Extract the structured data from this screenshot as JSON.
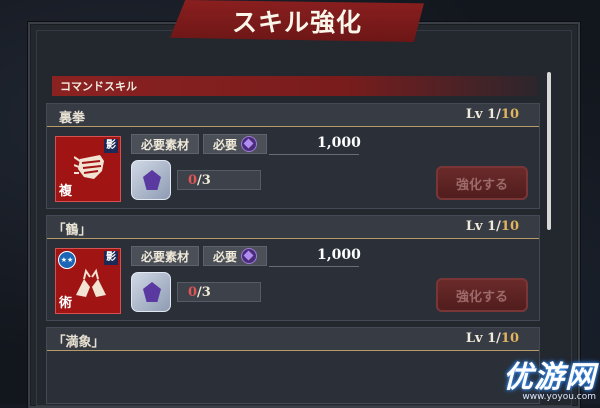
{
  "screen": {
    "title": "スキル強化"
  },
  "section": {
    "label": "コマンドスキル"
  },
  "skills": [
    {
      "name": "裏拳",
      "lv_label": "Lv",
      "lv_current": "1",
      "lv_max": "10",
      "kage": "影",
      "kind": "複",
      "req_material_label": "必要素材",
      "req_label": "必要",
      "req_value": "1,000",
      "count_have": "0",
      "count_need": "3",
      "button_label": "強化する"
    },
    {
      "name": "｢鶴｣",
      "lv_label": "Lv",
      "lv_current": "1",
      "lv_max": "10",
      "kage": "影",
      "kind": "術",
      "req_material_label": "必要素材",
      "req_label": "必要",
      "req_value": "1,000",
      "count_have": "0",
      "count_need": "3",
      "button_label": "強化する"
    },
    {
      "name": "｢満象｣",
      "lv_label": "Lv",
      "lv_current": "1",
      "lv_max": "10"
    }
  ],
  "watermark": {
    "main": "优游网",
    "sub": "www.yoyou.com"
  },
  "colors": {
    "accent_red": "#8a1f1f",
    "lv_max": "#e0b560",
    "count_have": "#e05555"
  }
}
